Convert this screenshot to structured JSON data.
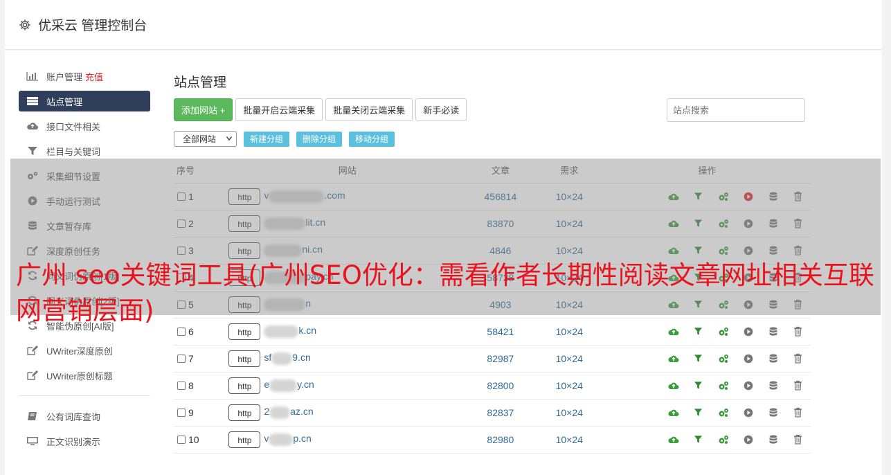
{
  "header": {
    "title": "优采云 管理控制台"
  },
  "sidebar": {
    "items": [
      {
        "label": "账户管理",
        "extra": "充值",
        "icon": "bar-chart-icon"
      },
      {
        "label": "站点管理",
        "icon": "server-icon",
        "active": true
      },
      {
        "label": "接口文件相关",
        "icon": "cloud-upload-icon"
      },
      {
        "label": "栏目与关键词",
        "icon": "filter-icon"
      },
      {
        "label": "采集细节设置",
        "icon": "gears-icon"
      },
      {
        "label": "手动运行测试",
        "icon": "play-circle-icon"
      },
      {
        "label": "文章暂存库",
        "icon": "database-icon"
      },
      {
        "label": "深度原创任务",
        "icon": "edit-icon"
      },
      {
        "label": "同义词伪原创[1版]",
        "icon": "refresh-icon"
      },
      {
        "label": "同义词伪原创[2版]",
        "icon": "refresh-icon"
      },
      {
        "label": "智能伪原创[AI版]",
        "icon": "refresh-icon"
      },
      {
        "label": "UWriter深度原创",
        "icon": "edit-icon"
      },
      {
        "label": "UWriter原创标题",
        "icon": "edit-icon"
      }
    ],
    "items2": [
      {
        "label": "公有词库查询",
        "icon": "book-icon"
      },
      {
        "label": "正文识别演示",
        "icon": "monitor-icon"
      }
    ]
  },
  "page": {
    "title": "站点管理",
    "buttons": {
      "add_site": "添加网站 +",
      "batch_open": "批量开启云端采集",
      "batch_close": "批量关闭云端采集",
      "beginner": "新手必读"
    },
    "search_placeholder": "站点搜索",
    "group_select": "全部网站",
    "group_buttons": {
      "new": "新建分组",
      "delete": "删除分组",
      "move": "移动分组"
    }
  },
  "table": {
    "headers": {
      "no": "序号",
      "site": "网站",
      "articles": "文章",
      "demand": "需求",
      "ops": "操作"
    },
    "rows": [
      {
        "no": "1",
        "protocol": "http",
        "prefix": "v",
        "suffix": ".com",
        "articles": "456814",
        "demand": "10×24",
        "running": true
      },
      {
        "no": "2",
        "protocol": "http",
        "prefix": "",
        "suffix": "lit.cn",
        "articles": "83870",
        "demand": "10×24",
        "running": false
      },
      {
        "no": "3",
        "protocol": "http",
        "prefix": "",
        "suffix": "ni.cn",
        "articles": "4846",
        "demand": "10×24",
        "running": false
      },
      {
        "no": "4",
        "protocol": "http",
        "prefix": "",
        "suffix": "pay.cn",
        "articles": "58728",
        "demand": "10×24",
        "running": false
      },
      {
        "no": "5",
        "protocol": "http",
        "prefix": "",
        "suffix": "n",
        "articles": "4903",
        "demand": "10×24",
        "running": false
      },
      {
        "no": "6",
        "protocol": "http",
        "prefix": "",
        "suffix": "k.cn",
        "articles": "58421",
        "demand": "10×24",
        "running": false
      },
      {
        "no": "7",
        "protocol": "http",
        "prefix": "sf",
        "suffix": "9.cn",
        "articles": "82987",
        "demand": "10×24",
        "running": false
      },
      {
        "no": "8",
        "protocol": "http",
        "prefix": "e",
        "suffix": "y.cn",
        "articles": "82800",
        "demand": "10×24",
        "running": false
      },
      {
        "no": "9",
        "protocol": "http",
        "prefix": "2",
        "suffix": "az.cn",
        "articles": "82837",
        "demand": "10×24",
        "running": false
      },
      {
        "no": "10",
        "protocol": "http",
        "prefix": "v",
        "suffix": "p.cn",
        "articles": "82980",
        "demand": "10×24",
        "running": false
      }
    ]
  },
  "overlay": {
    "headline": "广州 seo关键词工具(广州SEO优化：需看作者长期性阅读文章网址相关互联网营销层面)"
  },
  "colors": {
    "accent_green": "#5cb85c",
    "accent_blue": "#5bc0de",
    "active_nav": "#2f3e5a",
    "headline_red": "#e8131c"
  }
}
